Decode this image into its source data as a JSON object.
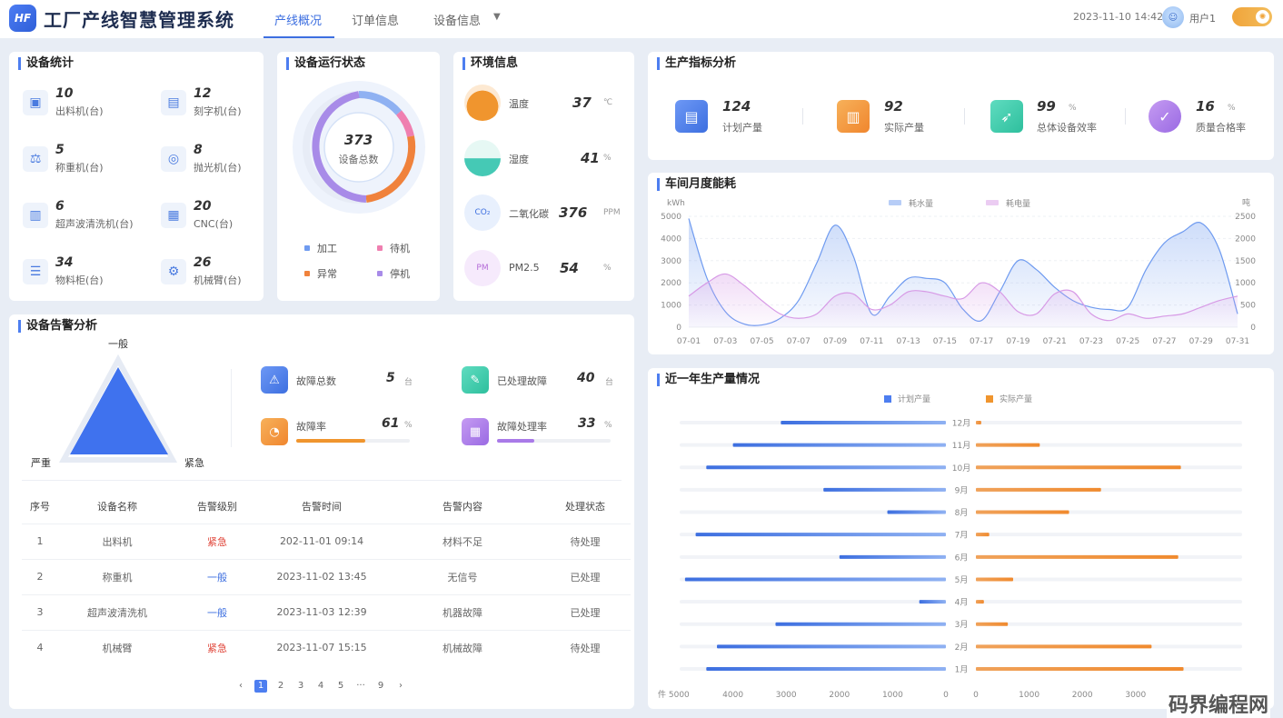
{
  "header": {
    "logo_text": "HF",
    "title": "工厂产线智慧管理系统",
    "tabs": [
      {
        "label": "产线概况",
        "active": true
      },
      {
        "label": "订单信息",
        "active": false
      },
      {
        "label": "设备信息",
        "active": false
      }
    ],
    "datetime": "2023-11-10 14:42",
    "user": "用户1",
    "accent": "#3d6fe0"
  },
  "device_stats": {
    "title": "设备统计",
    "items": [
      {
        "value": "10",
        "label": "出料机(台)",
        "icon": "discharger-icon"
      },
      {
        "value": "12",
        "label": "刻字机(台)",
        "icon": "engraver-icon"
      },
      {
        "value": "5",
        "label": "称重机(台)",
        "icon": "scale-icon"
      },
      {
        "value": "8",
        "label": "抛光机(台)",
        "icon": "polisher-icon"
      },
      {
        "value": "6",
        "label": "超声波清洗机(台)",
        "icon": "ultrasonic-cleaner-icon"
      },
      {
        "value": "20",
        "label": "CNC(台)",
        "icon": "cnc-icon"
      },
      {
        "value": "34",
        "label": "物料柜(台)",
        "icon": "cabinet-icon"
      },
      {
        "value": "26",
        "label": "机械臂(台)",
        "icon": "robot-arm-icon"
      }
    ]
  },
  "run_status": {
    "title": "设备运行状态",
    "total": "373",
    "total_label": "设备总数",
    "legend": [
      {
        "label": "加工",
        "color": "#6f9bf0"
      },
      {
        "label": "待机",
        "color": "#ef7fb0"
      },
      {
        "label": "异常",
        "color": "#f0823c"
      },
      {
        "label": "停机",
        "color": "#a88be8"
      }
    ]
  },
  "environment": {
    "title": "环境信息",
    "items": [
      {
        "label": "温度",
        "value": "37",
        "unit": "℃",
        "icon": "thermometer-icon",
        "color": "#f0952e"
      },
      {
        "label": "湿度",
        "value": "41",
        "unit": "%",
        "icon": "humidity-icon",
        "color": "#45c9b5"
      },
      {
        "label": "二氧化碳",
        "value": "376",
        "unit": "PPM",
        "icon": "co2-icon",
        "color": "#5b8ef0",
        "icon_text": "CO₂"
      },
      {
        "label": "PM2.5",
        "value": "54",
        "unit": "%",
        "icon": "pm25-icon",
        "color": "#c88ce8",
        "icon_text": "PM"
      }
    ]
  },
  "production_kpi": {
    "title": "生产指标分析",
    "items": [
      {
        "value": "124",
        "unit": "",
        "label": "计划产量",
        "icon": "document-icon",
        "color": "#4d7ef0"
      },
      {
        "value": "92",
        "unit": "",
        "label": "实际产量",
        "icon": "chart-board-icon",
        "color": "#f0952e"
      },
      {
        "value": "99",
        "unit": "%",
        "label": "总体设备效率",
        "icon": "rocket-icon",
        "color": "#3ec9a8"
      },
      {
        "value": "16",
        "unit": "%",
        "label": "质量合格率",
        "icon": "check-icon",
        "color": "#a97ae8"
      }
    ]
  },
  "alert_analysis": {
    "title": "设备告警分析",
    "radar_labels": [
      "一般",
      "严重",
      "紧急"
    ],
    "stats": [
      {
        "label": "故障总数",
        "value": "5",
        "unit": "台",
        "icon": "warning-icon",
        "color": "#4d7ef0"
      },
      {
        "label": "已处理故障",
        "value": "40",
        "unit": "台",
        "icon": "wrench-icon",
        "color": "#3ec9a8"
      },
      {
        "label": "故障率",
        "value": "61",
        "unit": "%",
        "icon": "pie-icon",
        "color": "#f0952e",
        "progress": 0.61
      },
      {
        "label": "故障处理率",
        "value": "33",
        "unit": "%",
        "icon": "calendar-clock-icon",
        "color": "#a97ae8",
        "progress": 0.33
      }
    ],
    "table": {
      "columns": [
        "序号",
        "设备名称",
        "告警级别",
        "告警时间",
        "告警内容",
        "处理状态"
      ],
      "rows": [
        [
          "1",
          "出料机",
          "紧急",
          "202-11-01 09:14",
          "材料不足",
          "待处理"
        ],
        [
          "2",
          "称重机",
          "一般",
          "2023-11-02 13:45",
          "无信号",
          "已处理"
        ],
        [
          "3",
          "超声波清洗机",
          "一般",
          "2023-11-03 12:39",
          "机器故障",
          "已处理"
        ],
        [
          "4",
          "机械臂",
          "紧急",
          "2023-11-07 15:15",
          "机械故障",
          "待处理"
        ]
      ]
    },
    "pager": {
      "prev": "‹",
      "pages": [
        "1",
        "2",
        "3",
        "4",
        "5",
        "···",
        "9"
      ],
      "current": "1",
      "next": "›"
    },
    "level_colors": {
      "紧急": "#e0463a",
      "一般": "#3d6fe0"
    }
  },
  "energy": {
    "title": "车间月度能耗",
    "left_unit": "kWh",
    "right_unit": "吨",
    "legend": [
      "耗水量",
      "耗电量"
    ]
  },
  "yearly_output": {
    "title": "近一年生产量情况",
    "legend": [
      "计划产量",
      "实际产量"
    ],
    "left_axis": [
      "件 5000",
      "4000",
      "3000",
      "2000",
      "1000",
      "0"
    ],
    "right_axis": [
      "0",
      "1000",
      "2000",
      "3000"
    ]
  },
  "chart_data": [
    {
      "type": "area",
      "title": "车间月度能耗",
      "x": [
        "07-01",
        "07-02",
        "07-03",
        "07-04",
        "07-05",
        "07-06",
        "07-07",
        "07-08",
        "07-09",
        "07-10",
        "07-11",
        "07-12",
        "07-13",
        "07-14",
        "07-15",
        "07-16",
        "07-17",
        "07-18",
        "07-19",
        "07-20",
        "07-21",
        "07-22",
        "07-23",
        "07-24",
        "07-25",
        "07-26",
        "07-27",
        "07-28",
        "07-29",
        "07-30",
        "07-31"
      ],
      "x_ticks": [
        "07-01",
        "07-03",
        "07-05",
        "07-07",
        "07-09",
        "07-11",
        "07-13",
        "07-15",
        "07-17",
        "07-19",
        "07-21",
        "07-23",
        "07-25",
        "07-27",
        "07-29",
        "07-31"
      ],
      "ylim_left": [
        0,
        5000
      ],
      "ylim_right": [
        0,
        2500
      ],
      "y_ticks_left": [
        0,
        1000,
        2000,
        3000,
        4000,
        5000
      ],
      "y_ticks_right": [
        0,
        500,
        1000,
        1500,
        2000,
        2500
      ],
      "ylabel_left": "kWh",
      "ylabel_right": "吨",
      "series": [
        {
          "name": "耗水量",
          "axis": "left",
          "color": "#6f9bf0",
          "values": [
            4900,
            2200,
            700,
            150,
            100,
            400,
            1200,
            2900,
            4600,
            3200,
            600,
            1400,
            2200,
            2200,
            2000,
            800,
            300,
            1600,
            3000,
            2600,
            1800,
            1200,
            900,
            800,
            900,
            2600,
            3800,
            4300,
            4700,
            3500,
            600
          ]
        },
        {
          "name": "耗电量",
          "axis": "right",
          "color": "#d79ae6",
          "values": [
            700,
            1000,
            1200,
            950,
            600,
            300,
            200,
            300,
            700,
            750,
            400,
            500,
            800,
            800,
            700,
            650,
            1000,
            800,
            350,
            300,
            750,
            800,
            300,
            150,
            300,
            200,
            250,
            300,
            450,
            600,
            700
          ]
        }
      ]
    },
    {
      "type": "bar",
      "title": "近一年生产量情况",
      "categories": [
        "1月",
        "2月",
        "3月",
        "4月",
        "5月",
        "6月",
        "7月",
        "8月",
        "9月",
        "10月",
        "11月",
        "12月"
      ],
      "series": [
        {
          "name": "计划产量",
          "color": "#4d7ef0",
          "values": [
            4500,
            4300,
            3200,
            500,
            4900,
            2000,
            4700,
            1100,
            2300,
            4500,
            4000,
            3100
          ]
        },
        {
          "name": "实际产量",
          "color": "#f0952e",
          "values": [
            3900,
            3300,
            600,
            150,
            700,
            3800,
            250,
            1750,
            2350,
            3850,
            1200,
            100
          ]
        }
      ],
      "xlim_left": [
        5000,
        0
      ],
      "xlim_right": [
        0,
        5000
      ]
    }
  ]
}
